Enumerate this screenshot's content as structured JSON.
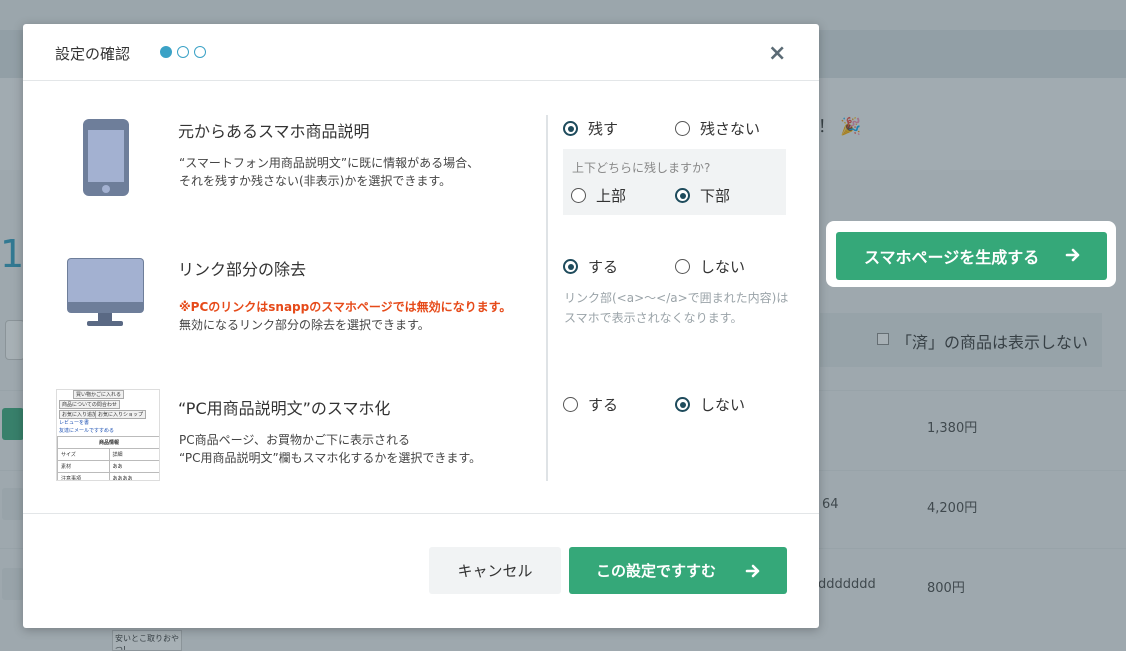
{
  "modal": {
    "title": "設定の確認",
    "steps_total": 3,
    "steps_current": 1,
    "rows": [
      {
        "title": "元からあるスマホ商品説明",
        "desc_lines": [
          "“スマートフォン用商品説明文”に既に情報がある場合、",
          "それを残すか残さない(非表示)かを選択できます。"
        ],
        "options": [
          {
            "label": "残す",
            "checked": true
          },
          {
            "label": "残さない",
            "checked": false
          }
        ],
        "sub": {
          "question": "上下どちらに残しますか?",
          "options": [
            {
              "label": "上部",
              "checked": false
            },
            {
              "label": "下部",
              "checked": true
            }
          ]
        }
      },
      {
        "title": "リンク部分の除去",
        "warning": "※PCのリンクはsnappのスマホページでは無効になります。",
        "desc_lines": [
          "無効になるリンク部分の除去を選択できます。"
        ],
        "options": [
          {
            "label": "する",
            "checked": true
          },
          {
            "label": "しない",
            "checked": false
          }
        ],
        "hint_lines": [
          "リンク部(<a>〜</a>で囲まれた内容)は",
          "スマホで表示されなくなります。"
        ]
      },
      {
        "title": "“PC用商品説明文”のスマホ化",
        "desc_lines": [
          "PC商品ページ、お買物かご下に表示される",
          "“PC用商品説明文”欄もスマホ化するかを選択できます。"
        ],
        "options": [
          {
            "label": "する",
            "checked": false
          },
          {
            "label": "しない",
            "checked": true
          }
        ]
      }
    ],
    "cancel_label": "キャンセル",
    "confirm_label": "この設定ですすむ",
    "illustration_page": {
      "button1": "買い物かごに入れる",
      "button2": "商品についての問合わせ",
      "small1": "お気に入り追加",
      "small2": "お気に入りショップ",
      "link1": "レビューを書",
      "link2": "友達にメールですすめる",
      "table_header": "商品情報",
      "table_rows": [
        [
          "サイズ",
          "詳細"
        ],
        [
          "素材",
          "ああ"
        ],
        [
          "注意事項",
          "ああああ"
        ]
      ]
    }
  },
  "generate_button_label": "スマホページを生成する",
  "background": {
    "banner_text": "！",
    "big_number": "1",
    "filter_label": "「済」の商品は表示しない",
    "prices": [
      "1,380円",
      "4,200円",
      "800円"
    ],
    "row2_id": "64",
    "row3_id": "ddddddd",
    "thumb_text": "安いとこ取りおやつ!"
  },
  "colors": {
    "green": "#35a879",
    "step_blue": "#3ba2c6",
    "warning_red": "#e64a19",
    "radio_dark": "#1e4b5c"
  }
}
